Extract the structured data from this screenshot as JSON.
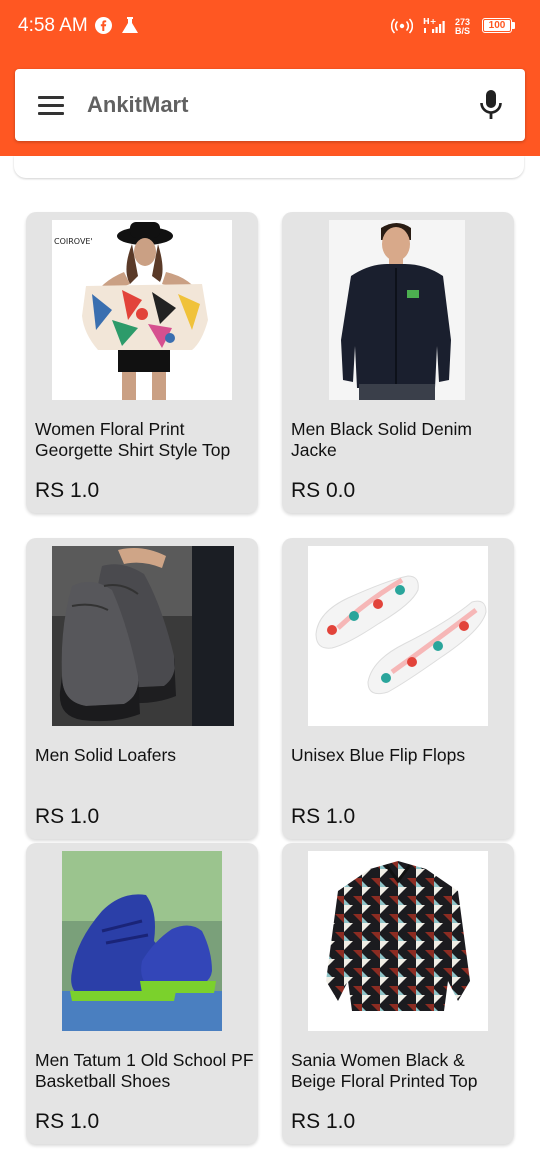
{
  "status_bar": {
    "time": "4:58 AM",
    "net_speed": "273",
    "net_unit": "B/S",
    "battery": "100",
    "signal_label": "H+"
  },
  "header": {
    "app_title": "AnkitMart",
    "accent_color": "#FF5722",
    "menu_icon": "hamburger-menu-icon",
    "mic_icon": "microphone-icon"
  },
  "products": [
    {
      "name": "Women  Floral Print Georgette Shirt Style Top",
      "price": "RS 1.0",
      "image_brand": "COIROVE'"
    },
    {
      "name": "Men Black Solid Denim Jacke",
      "price": "RS 0.0"
    },
    {
      "name": "Men Solid Loafers",
      "price": "RS 1.0"
    },
    {
      "name": "Unisex Blue Flip Flops",
      "price": "RS 1.0"
    },
    {
      "name": "Men Tatum 1 Old School PF Basketball Shoes",
      "price": "RS 1.0"
    },
    {
      "name": "Sania Women Black & Beige Floral Printed Top",
      "price": "RS 1.0"
    }
  ]
}
